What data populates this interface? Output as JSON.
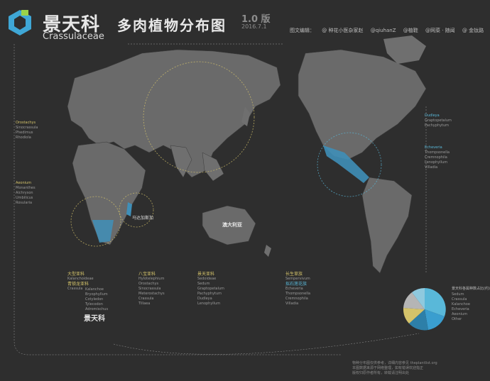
{
  "header": {
    "brand_cn": "景天科",
    "title_cn": "多肉植物分布图",
    "brand_en": "Crassulaceae",
    "version": "1.0 版",
    "date": "2016.7.1",
    "credits": [
      "图文编辑：",
      "@ 种花小医杂家赵",
      "@qiuhanZ",
      "@植鞋",
      "@网菜 · 随闻",
      "@ 金钛路"
    ]
  },
  "map_labels": {
    "madagascar": "马达加斯加",
    "australia": "澳大利亚"
  },
  "left_panel": {
    "items": [
      "Orostachys",
      "Sinocrassula",
      "Phedimus",
      "Rhodiola",
      "Aeonium",
      "Monanthes",
      "Aichryson",
      "Umbilicus",
      "Rosularia"
    ]
  },
  "bottom_tree": {
    "root": "景天科",
    "groups": [
      {
        "label": "大型亚科",
        "sub": "Kalanchoideae"
      },
      {
        "label": "青锁龙亚科",
        "sub": "Crassula"
      },
      {
        "label": "八宝亚科",
        "sub": "Hylotelephium"
      },
      {
        "label": "长生草族",
        "sub": "Sempervivum"
      },
      {
        "label": "拟石莲花族",
        "sub": "Echeveria"
      },
      {
        "label": "景天亚科",
        "sub": "Sedoideae"
      }
    ],
    "genera_col1": [
      "Kalanchoe",
      "Bryophyllum",
      "Cotyledon",
      "Tylecodon",
      "Adromischus"
    ],
    "genera_col2": [
      "Crassula",
      "Tillaea"
    ],
    "genera_col3": [
      "Hylotelephium",
      "Orostachys",
      "Sinocrassula",
      "Meterostachys"
    ],
    "genera_col4": [
      "Sedum",
      "Graptopetalum",
      "Pachyphytum",
      "Dudleya",
      "Lenophyllum"
    ],
    "genera_col5": [
      "Echeveria",
      "Thompsonella",
      "Cremnophila",
      "Villadia"
    ]
  },
  "right_panel": {
    "groups": [
      "Dudleya",
      "Graptopetalum",
      "Pachyphytum",
      "Echeveria",
      "Thompsonella",
      "Cremnophila",
      "Lenophyllum",
      "Villadia"
    ]
  },
  "pie": {
    "title": "景天科各属种数占比(约)",
    "legend": [
      "Sedum",
      "Crassula",
      "Kalanchoe",
      "Echeveria",
      "Aeonium",
      "Other"
    ]
  },
  "footer": {
    "lines": [
      "物种分布图仅供参考，详细内容参见 theplantlist.org",
      "本图数据来源于网络整理，如有错误欢迎指正",
      "版权归原作者所有，转载请注明出处"
    ]
  },
  "colors": {
    "background": "#2e2e2e",
    "land": "#6a6a6a",
    "highlight_land": "#3f8fb8",
    "accent_cyan": "#59b8d9",
    "accent_yellow": "#d4c36a"
  }
}
